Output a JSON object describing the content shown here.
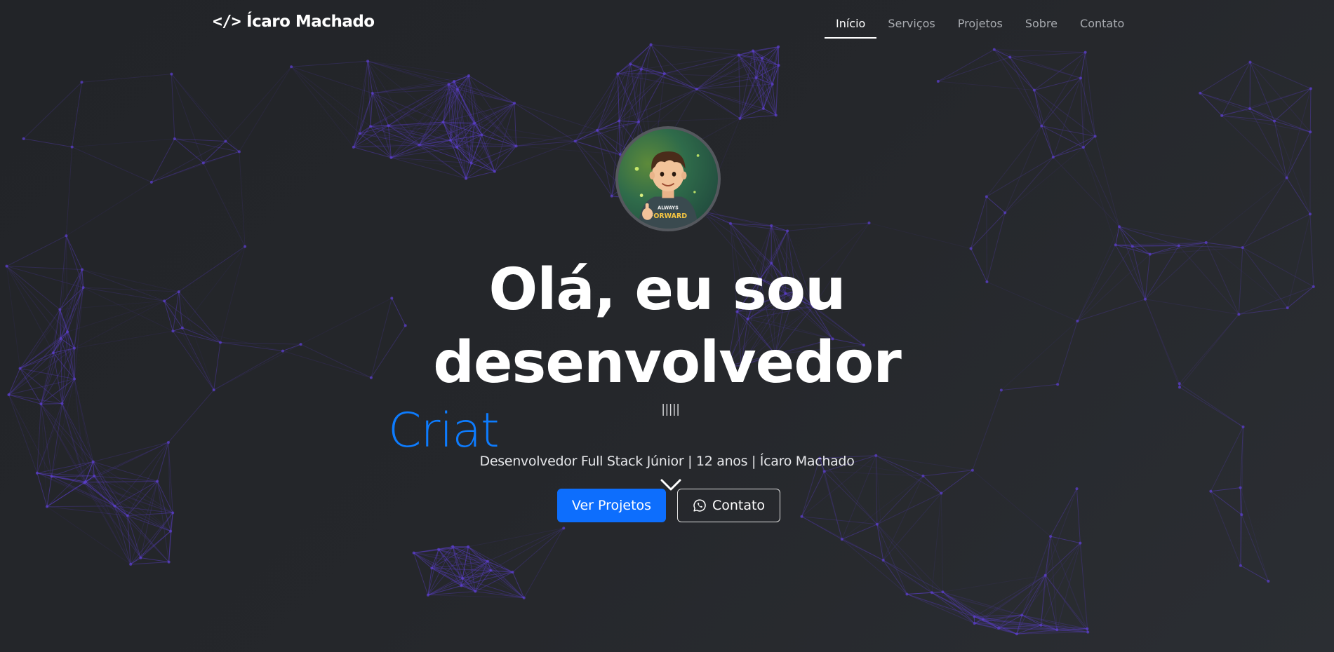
{
  "brand": {
    "icon": "code-icon",
    "icon_glyph": "</>",
    "name": "Ícaro Machado"
  },
  "nav": {
    "items": [
      {
        "label": "Início",
        "active": true
      },
      {
        "label": "Serviços",
        "active": false
      },
      {
        "label": "Projetos",
        "active": false
      },
      {
        "label": "Sobre",
        "active": false
      },
      {
        "label": "Contato",
        "active": false
      }
    ]
  },
  "hero": {
    "title_line1": "Olá, eu sou",
    "title_line2": "desenvolvedor",
    "cursor": "|||||",
    "typed_text": "Criat",
    "subtitle": "Desenvolvedor Full Stack Júnior | 12 anos | Ícaro Machado",
    "avatar_shirt_text_1": "ALWAYS",
    "avatar_shirt_text_2": "FORWARD"
  },
  "buttons": {
    "primary_label": "Ver Projetos",
    "secondary_label": "Contato",
    "secondary_icon": "whatsapp-icon"
  },
  "colors": {
    "background": "#25272b",
    "accent": "#0d6efd",
    "typed_text": "#0d7cff",
    "network_lines": "#5b3fc9"
  }
}
